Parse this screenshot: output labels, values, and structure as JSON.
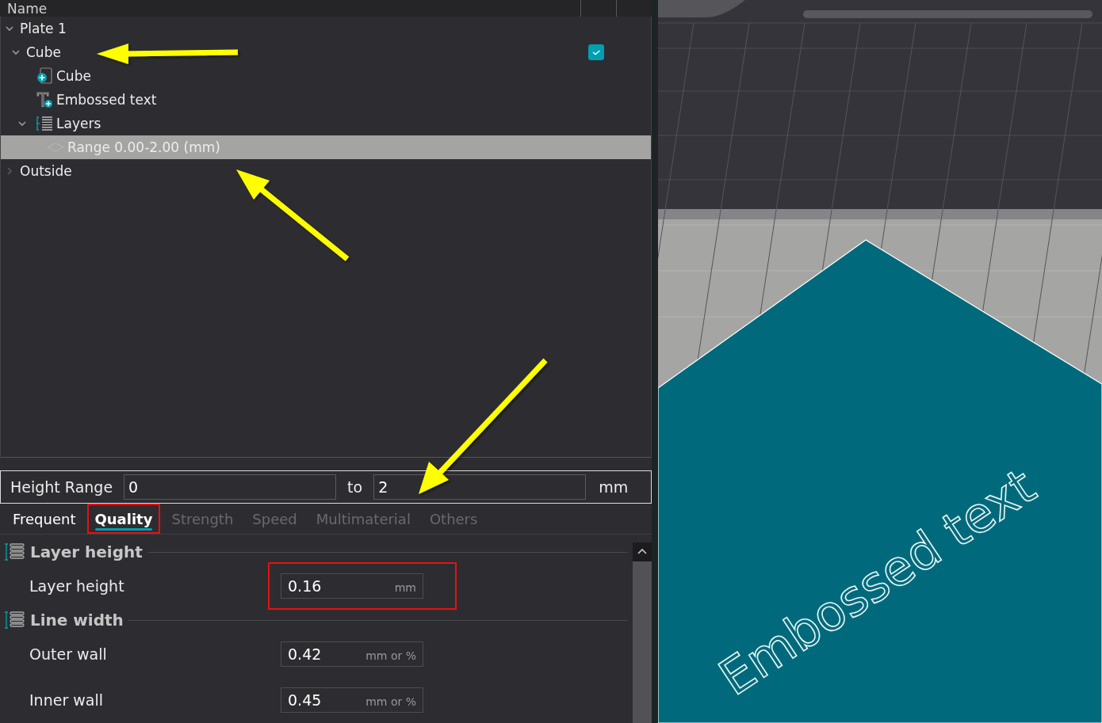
{
  "tree": {
    "column_header": "Name",
    "items": [
      {
        "label": "Plate 1",
        "expanded": true,
        "selected": false,
        "children": [
          {
            "label": "Cube",
            "expanded": true,
            "checked": true,
            "selected": false,
            "children": [
              {
                "label": "Cube",
                "kind": "part",
                "selected": false
              },
              {
                "label": "Embossed text",
                "kind": "text",
                "selected": false
              },
              {
                "label": "Layers",
                "kind": "layers",
                "expanded": true,
                "selected": false,
                "children": [
                  {
                    "label": "Range 0.00-2.00 (mm)",
                    "kind": "range",
                    "selected": true
                  }
                ]
              }
            ]
          }
        ]
      },
      {
        "label": "Outside",
        "expanded": false,
        "selected": false
      }
    ]
  },
  "height_range": {
    "label": "Height Range",
    "from": "0",
    "separator": "to",
    "to": "2",
    "unit": "mm"
  },
  "tabs": [
    {
      "label": "Frequent",
      "selected": false,
      "disabled": false,
      "annotated": false
    },
    {
      "label": "Quality",
      "selected": true,
      "disabled": false,
      "annotated": true
    },
    {
      "label": "Strength",
      "selected": false,
      "disabled": true,
      "annotated": false
    },
    {
      "label": "Speed",
      "selected": false,
      "disabled": true,
      "annotated": false
    },
    {
      "label": "Multimaterial",
      "selected": false,
      "disabled": true,
      "annotated": false
    },
    {
      "label": "Others",
      "selected": false,
      "disabled": true,
      "annotated": false
    }
  ],
  "settings": [
    {
      "title": "Layer height",
      "options": [
        {
          "label": "Layer height",
          "value": "0.16",
          "unit": "mm",
          "annotated": true
        }
      ]
    },
    {
      "title": "Line width",
      "options": [
        {
          "label": "Outer wall",
          "value": "0.42",
          "unit": "mm or %",
          "annotated": false
        },
        {
          "label": "Inner wall",
          "value": "0.45",
          "unit": "mm or %",
          "annotated": false
        }
      ]
    }
  ],
  "viewport": {
    "model_text": "Embossed text"
  }
}
